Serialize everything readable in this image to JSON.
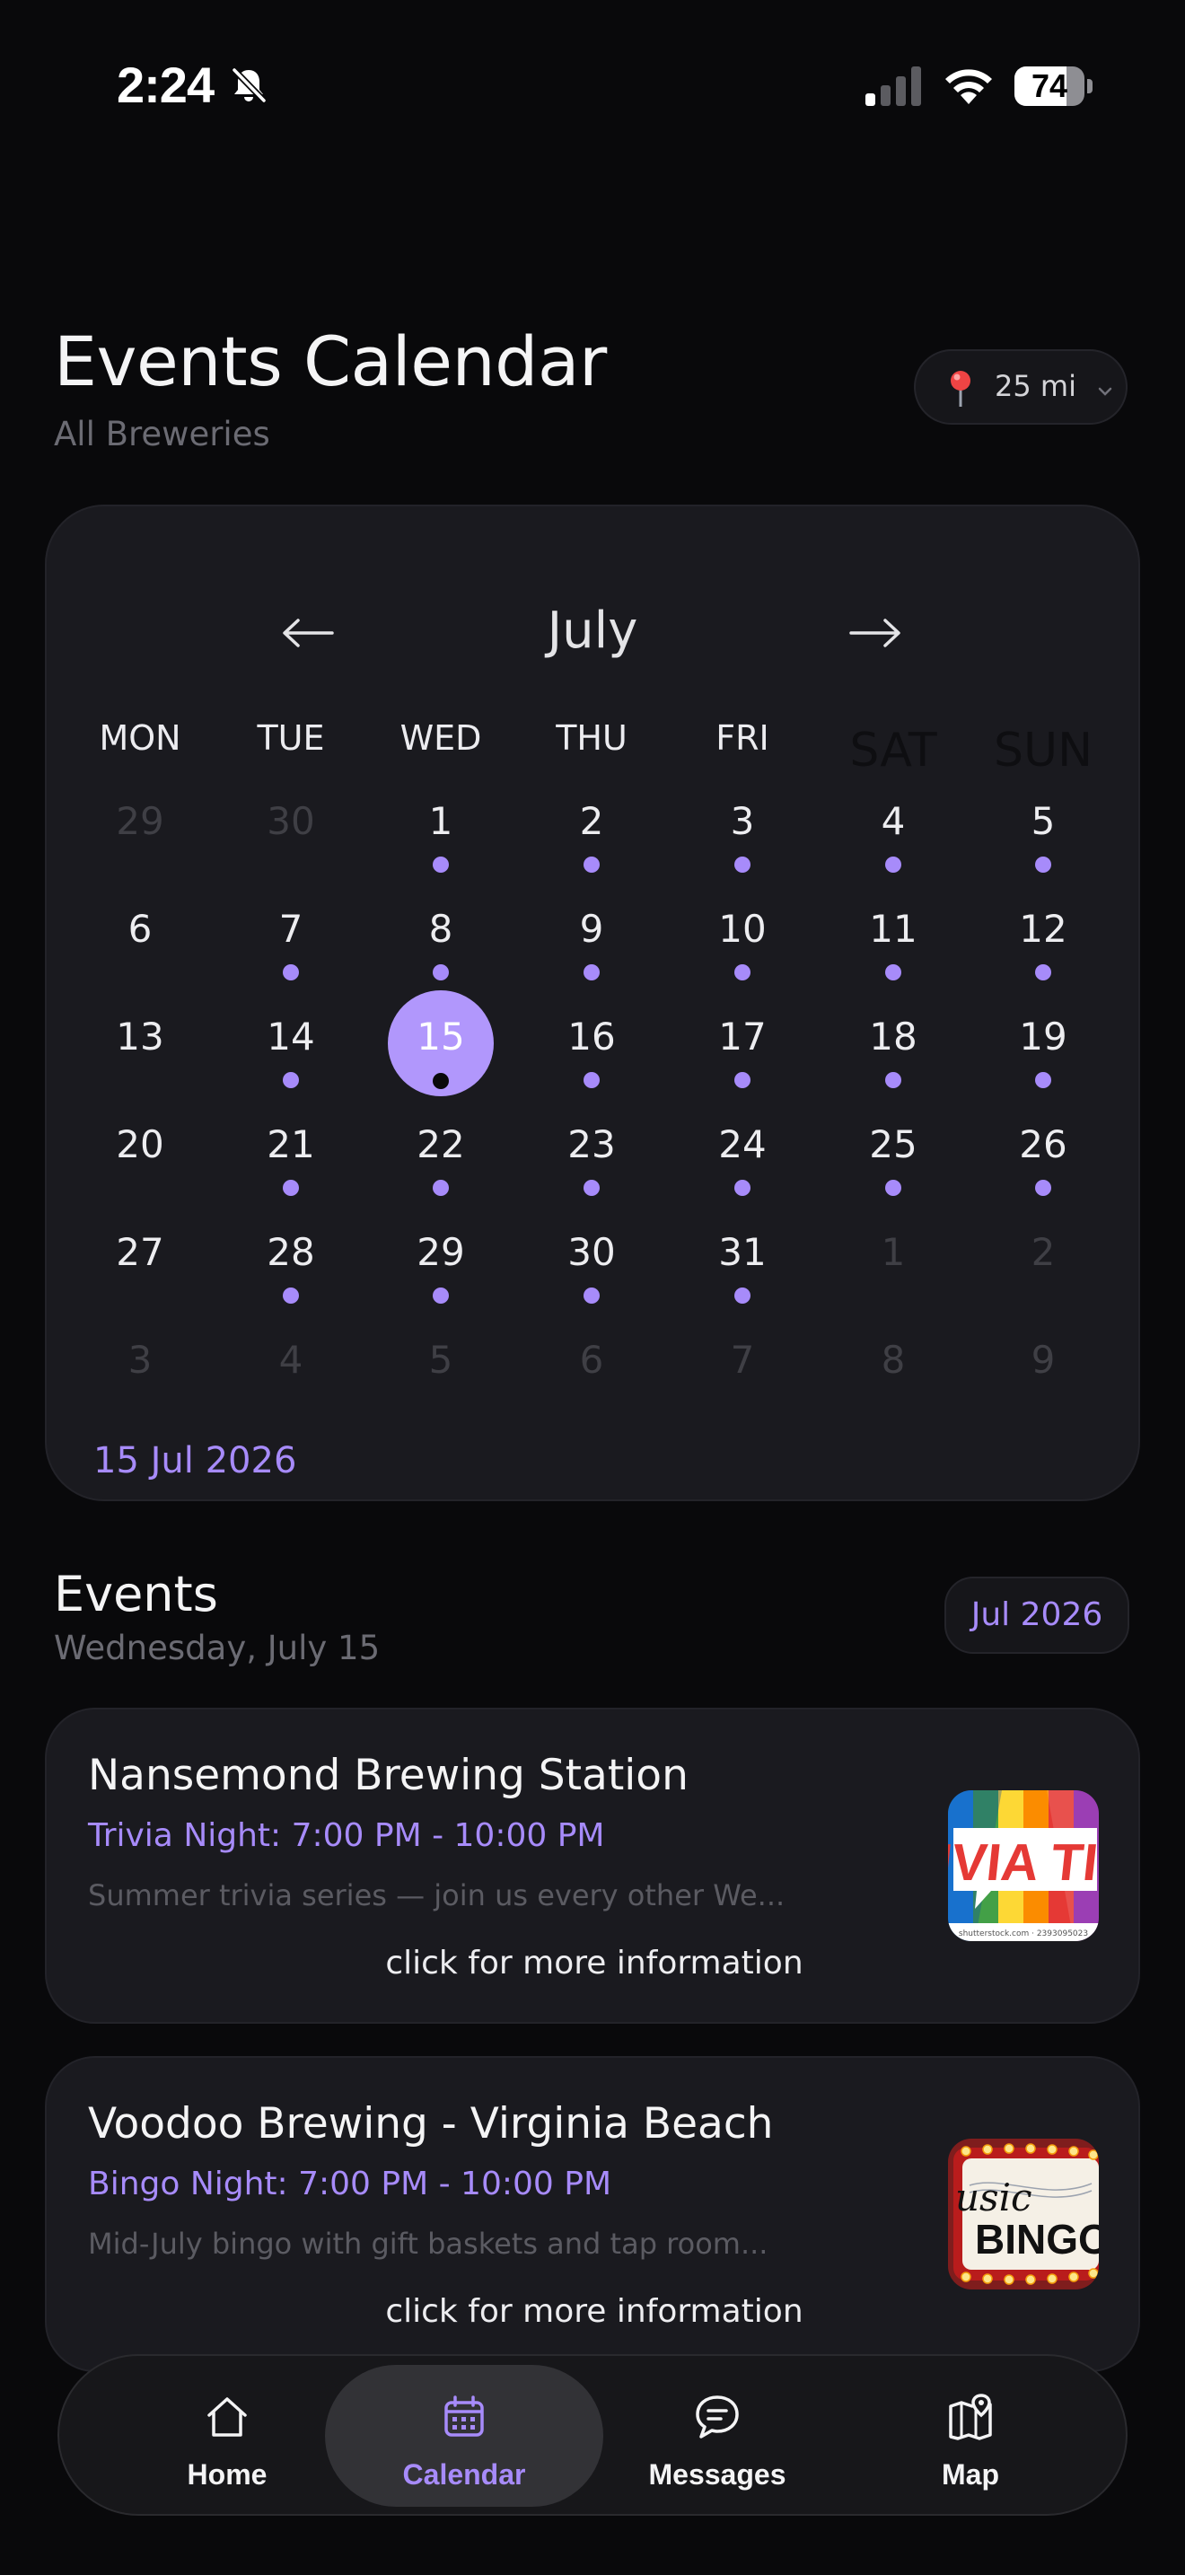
{
  "status_bar": {
    "time": "2:24",
    "battery": "74",
    "battery_level": 0.74,
    "icons": [
      "bell-slash-icon",
      "cellular-signal-icon",
      "wifi-icon",
      "battery-icon"
    ]
  },
  "header": {
    "title": "Events Calendar",
    "subtitle": "All Breweries",
    "radius_label": "25 mi",
    "radius_icons": [
      "map-pin-icon",
      "chevron-down-icon"
    ]
  },
  "calendar": {
    "month": "July",
    "prev_icon": "arrow-left-icon",
    "next_icon": "arrow-right-icon",
    "weekdays": [
      "MON",
      "TUE",
      "WED",
      "THU",
      "FRI",
      "SAT",
      "SUN"
    ],
    "weeks": [
      [
        {
          "d": "29",
          "muted": true,
          "dot": false
        },
        {
          "d": "30",
          "muted": true,
          "dot": false
        },
        {
          "d": "1",
          "dot": true
        },
        {
          "d": "2",
          "dot": true
        },
        {
          "d": "3",
          "dot": true
        },
        {
          "d": "4",
          "dot": true
        },
        {
          "d": "5",
          "dot": true
        }
      ],
      [
        {
          "d": "6",
          "dot": false
        },
        {
          "d": "7",
          "dot": true
        },
        {
          "d": "8",
          "dot": true
        },
        {
          "d": "9",
          "dot": true
        },
        {
          "d": "10",
          "dot": true
        },
        {
          "d": "11",
          "dot": true
        },
        {
          "d": "12",
          "dot": true
        }
      ],
      [
        {
          "d": "13",
          "dot": false
        },
        {
          "d": "14",
          "dot": true
        },
        {
          "d": "15",
          "dot": true,
          "selected": true
        },
        {
          "d": "16",
          "dot": true
        },
        {
          "d": "17",
          "dot": true
        },
        {
          "d": "18",
          "dot": true
        },
        {
          "d": "19",
          "dot": true
        }
      ],
      [
        {
          "d": "20",
          "dot": false
        },
        {
          "d": "21",
          "dot": true
        },
        {
          "d": "22",
          "dot": true
        },
        {
          "d": "23",
          "dot": true
        },
        {
          "d": "24",
          "dot": true
        },
        {
          "d": "25",
          "dot": true
        },
        {
          "d": "26",
          "dot": true
        }
      ],
      [
        {
          "d": "27",
          "dot": false
        },
        {
          "d": "28",
          "dot": true
        },
        {
          "d": "29",
          "dot": true
        },
        {
          "d": "30",
          "dot": true
        },
        {
          "d": "31",
          "dot": true
        },
        {
          "d": "1",
          "muted": true,
          "dot": false
        },
        {
          "d": "2",
          "muted": true,
          "dot": false
        }
      ],
      [
        {
          "d": "3",
          "muted": true,
          "dot": false
        },
        {
          "d": "4",
          "muted": true,
          "dot": false
        },
        {
          "d": "5",
          "muted": true,
          "dot": false
        },
        {
          "d": "6",
          "muted": true,
          "dot": false
        },
        {
          "d": "7",
          "muted": true,
          "dot": false
        },
        {
          "d": "8",
          "muted": true,
          "dot": false
        },
        {
          "d": "9",
          "muted": true,
          "dot": false
        }
      ]
    ],
    "selected_date": "15 Jul 2026"
  },
  "events_section": {
    "title": "Events",
    "date": "Wednesday, July 15",
    "month_pill": "Jul 2026"
  },
  "events": [
    {
      "venue": "Nansemond Brewing Station",
      "title": "Trivia Night: 7:00 PM - 10:00 PM",
      "description": "Summer trivia series — join us every other We...",
      "more": "click for more information",
      "thumb_text": "IVIA TI",
      "thumb_caption": "shutterstock.com · 2393095023"
    },
    {
      "venue": "Voodoo Brewing - Virginia Beach",
      "title": "Bingo Night: 7:00 PM - 10:00 PM",
      "description": "Mid-July bingo with gift baskets and tap room...",
      "more": "click for more information",
      "thumb_text": "BINGO",
      "thumb_script": "usic"
    }
  ],
  "nav": [
    {
      "label": "Home",
      "icon": "home-icon",
      "active": false
    },
    {
      "label": "Calendar",
      "icon": "calendar-icon",
      "active": true
    },
    {
      "label": "Messages",
      "icon": "chat-bubbles-icon",
      "active": false
    },
    {
      "label": "Map",
      "icon": "map-icon",
      "active": false
    }
  ],
  "colors": {
    "background": "#09090b",
    "card": "#1a1a1f",
    "accent": "#a78bfa",
    "selected_day": "#b197fc",
    "muted_text": "#6b6b73"
  }
}
